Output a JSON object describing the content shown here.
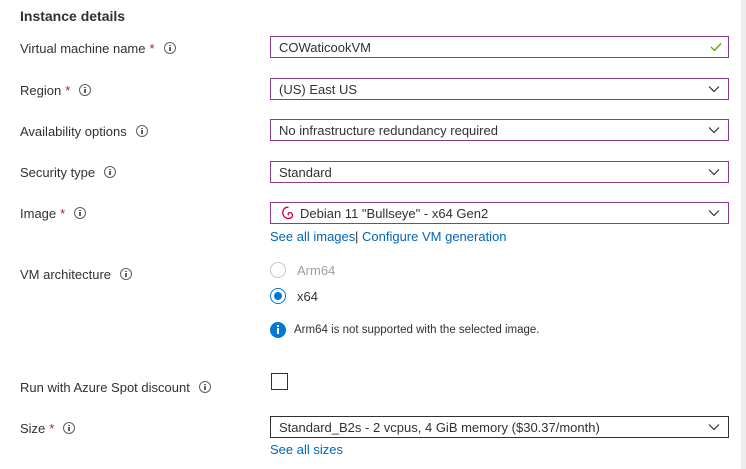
{
  "section": {
    "title": "Instance details"
  },
  "fields": {
    "vm_name": {
      "label": "Virtual machine name",
      "required": "*",
      "value": "COWaticookVM"
    },
    "region": {
      "label": "Region",
      "required": "*",
      "value": "(US) East US"
    },
    "availability": {
      "label": "Availability options",
      "value": "No infrastructure redundancy required"
    },
    "security": {
      "label": "Security type",
      "value": "Standard"
    },
    "image": {
      "label": "Image",
      "required": "*",
      "value": "Debian 11 \"Bullseye\" - x64 Gen2",
      "link_all": "See all images",
      "separator": "|",
      "link_config": "Configure VM generation"
    },
    "architecture": {
      "label": "VM architecture",
      "options": [
        "Arm64",
        "x64"
      ],
      "selected": "x64",
      "message": "Arm64 is not supported with the selected image."
    },
    "spot": {
      "label": "Run with Azure Spot discount"
    },
    "size": {
      "label": "Size",
      "required": "*",
      "value": "Standard_B2s - 2 vcpus, 4 GiB memory ($30.37/month)",
      "link_all": "See all sizes"
    }
  },
  "colors": {
    "accent_border": "#8a3d8f",
    "link": "#0066b8",
    "required": "#a4262c",
    "radio_selected": "#0078d4",
    "valid_check": "#57a300"
  },
  "icons": [
    "info-icon",
    "chevron-down-icon",
    "checkmark-icon",
    "debian-logo-icon",
    "info-filled-icon"
  ]
}
